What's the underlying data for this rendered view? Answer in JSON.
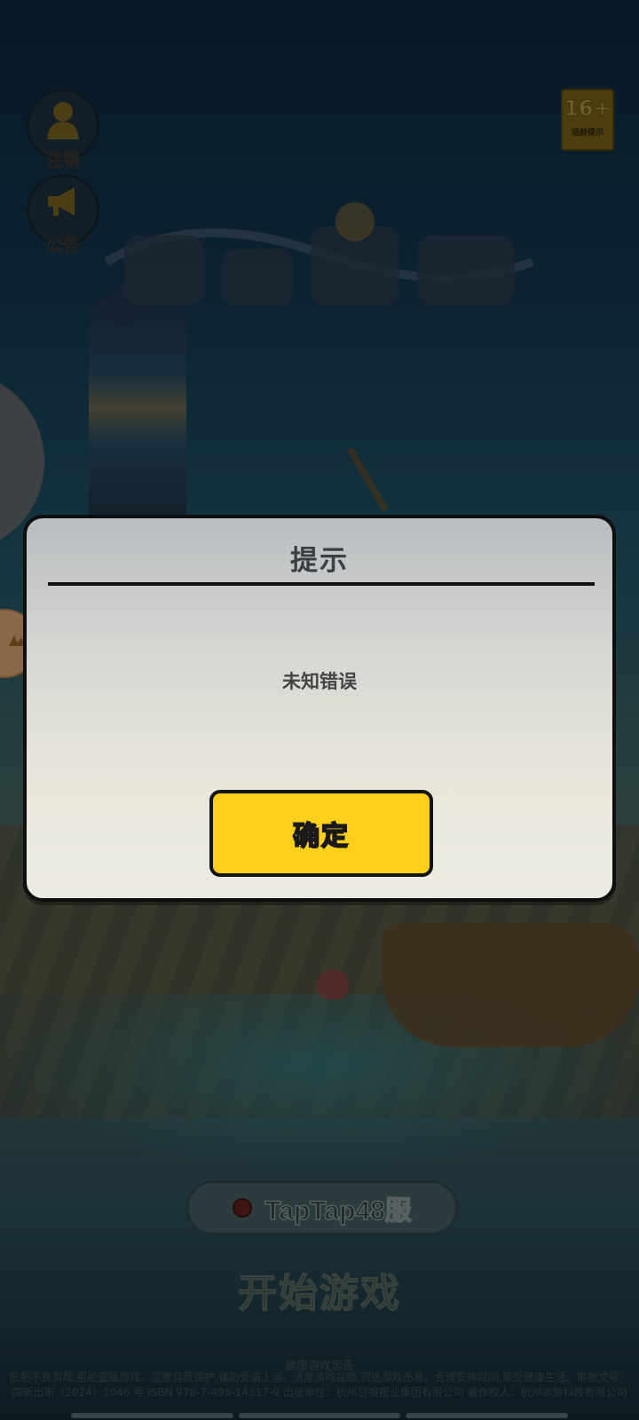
{
  "side_buttons": {
    "logout_label": "注销",
    "notice_label": "公告"
  },
  "age_badge": {
    "number": "16+",
    "label": "适龄提示"
  },
  "server": {
    "name": "TapTap48服"
  },
  "start_button_label": "开始游戏",
  "health_notice": {
    "title": "健康游戏忠告",
    "text": "抵制不良游戏,拒绝盗版游戏。注意自我保护,谨防受骗上当。适度游戏益脑,沉迷游戏伤身。合理安排时间,享受健康生活。审批文号：国新出审〔2024〕1046 号 ISBN 978-7-498-14317-9 出版单位：杭州日报报业集团有限公司 著作权人：杭州冰鱼科技有限公司"
  },
  "dialog": {
    "title": "提示",
    "message": "未知错误",
    "confirm_label": "确定"
  },
  "colors": {
    "confirm_button": "#fecf1b",
    "dialog_border": "#0f0f0f"
  }
}
